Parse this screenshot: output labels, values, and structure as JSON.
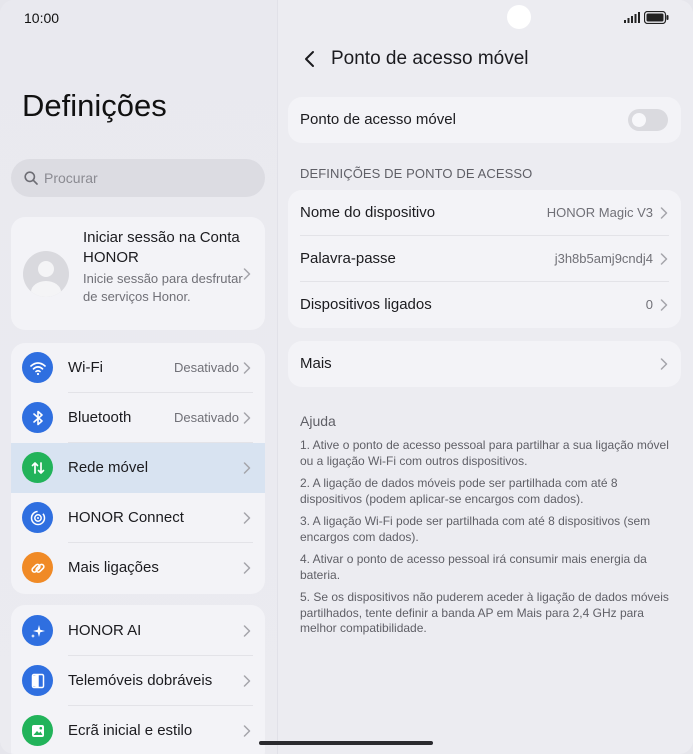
{
  "status_bar": {
    "time": "10:00"
  },
  "left": {
    "title": "Definições",
    "search": {
      "placeholder": "Procurar"
    },
    "account": {
      "title": "Iniciar sessão na Conta HONOR",
      "subtitle": "Inicie sessão para desfrutar de serviços Honor."
    },
    "group1": [
      {
        "label": "Wi-Fi",
        "value": "Desativado",
        "icon": "wifi-icon",
        "color": "#2f6fe0"
      },
      {
        "label": "Bluetooth",
        "value": "Desativado",
        "icon": "bluetooth-icon",
        "color": "#2f6fe0"
      },
      {
        "label": "Rede móvel",
        "value": "",
        "icon": "mobile-data-icon",
        "color": "#22b35a",
        "active": true
      },
      {
        "label": "HONOR Connect",
        "value": "",
        "icon": "honor-connect-icon",
        "color": "#2f6fe0"
      },
      {
        "label": "Mais ligações",
        "value": "",
        "icon": "link-icon",
        "color": "#f08a26"
      }
    ],
    "group2": [
      {
        "label": "HONOR AI",
        "icon": "ai-sparkle-icon",
        "color": "#2f6fe0"
      },
      {
        "label": "Telemóveis dobráveis",
        "icon": "foldable-icon",
        "color": "#2f6fe0"
      },
      {
        "label": "Ecrã inicial e estilo",
        "icon": "home-screen-icon",
        "color": "#22b35a"
      }
    ]
  },
  "right": {
    "title": "Ponto de acesso móvel",
    "hotspot_toggle": {
      "label": "Ponto de acesso móvel",
      "state": "off"
    },
    "section_header": "DEFINIÇÕES DE PONTO DE ACESSO",
    "settings": [
      {
        "label": "Nome do dispositivo",
        "value": "HONOR Magic V3"
      },
      {
        "label": "Palavra-passe",
        "value": "j3h8b5amj9cndj4"
      },
      {
        "label": "Dispositivos ligados",
        "value": "0"
      }
    ],
    "more": {
      "label": "Mais"
    },
    "help": {
      "title": "Ajuda",
      "items": [
        "1. Ative o ponto de acesso pessoal para partilhar a sua ligação móvel ou a ligação Wi-Fi com outros dispositivos.",
        "2. A ligação de dados móveis pode ser partilhada com até 8 dispositivos (podem aplicar-se encargos com dados).",
        "3. A ligação Wi-Fi pode ser partilhada com até 8 dispositivos (sem encargos com dados).",
        "4. Ativar o ponto de acesso pessoal irá consumir mais energia da bateria.",
        "5. Se os dispositivos não puderem aceder à ligação de dados móveis partilhados, tente definir a banda AP em Mais para 2,4 GHz para melhor compatibilidade."
      ]
    }
  }
}
